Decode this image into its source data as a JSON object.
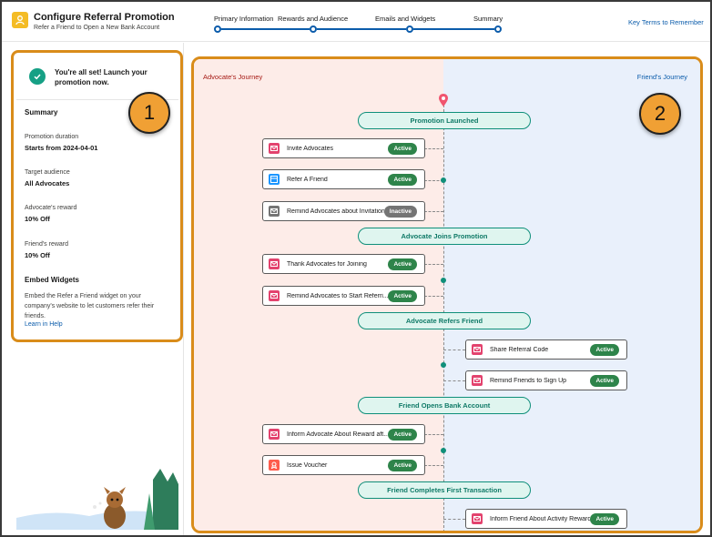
{
  "header": {
    "title": "Configure Referral Promotion",
    "subtitle": "Refer a Friend to Open a New Bank Account",
    "steps": [
      "Primary Information",
      "Rewards and Audience",
      "Emails and Widgets",
      "Summary"
    ],
    "key_terms_link": "Key Terms to Remember"
  },
  "left": {
    "success_message": "You're all set! Launch your promotion now.",
    "summary_title": "Summary",
    "items": [
      {
        "label": "Promotion duration",
        "value": "Starts from 2024-04-01"
      },
      {
        "label": "Target audience",
        "value": "All Advocates"
      },
      {
        "label": "Advocate's reward",
        "value": "10% Off"
      },
      {
        "label": "Friend's reward",
        "value": "10% Off"
      }
    ],
    "embed_title": "Embed Widgets",
    "embed_desc": "Embed the Refer a Friend widget on your company's website to let customers refer their friends.",
    "learn_link": "Learn in Help"
  },
  "callouts": [
    "1",
    "2"
  ],
  "journey": {
    "advocate_lane": "Advocate's Journey",
    "friend_lane": "Friend's Journey",
    "phases": [
      "Promotion Launched",
      "Advocate Joins Promotion",
      "Advocate Refers Friend",
      "Friend Opens Bank Account",
      "Friend Completes First Transaction"
    ],
    "steps": [
      {
        "label": "Invite Advocates",
        "status": "Active",
        "icon": "email-icon"
      },
      {
        "label": "Refer A Friend",
        "status": "Active",
        "icon": "widget-icon"
      },
      {
        "label": "Remind Advocates about Invitation",
        "status": "Inactive",
        "icon": "email-icon"
      },
      {
        "label": "Thank Advocates for Joining",
        "status": "Active",
        "icon": "email-icon"
      },
      {
        "label": "Remind Advocates to Start Referri...",
        "status": "Active",
        "icon": "email-icon"
      },
      {
        "label": "Share Referral Code",
        "status": "Active",
        "icon": "email-icon"
      },
      {
        "label": "Remind Friends to Sign Up",
        "status": "Active",
        "icon": "email-icon"
      },
      {
        "label": "Inform Advocate About Reward aft...",
        "status": "Active",
        "icon": "email-icon"
      },
      {
        "label": "Issue Voucher",
        "status": "Active",
        "icon": "voucher-icon"
      },
      {
        "label": "Inform Friend About Activity Reward",
        "status": "Active",
        "icon": "email-icon"
      }
    ]
  },
  "colors": {
    "accent": "#0b5cab",
    "phase_teal": "#0f8f7a",
    "active_green": "#2e844a",
    "inactive_gray": "#747474",
    "callout_orange": "#f0a034",
    "email_icon_pink": "#e3436e",
    "widget_icon_blue": "#1b96ff",
    "voucher_icon_orange": "#fe5c4c"
  }
}
